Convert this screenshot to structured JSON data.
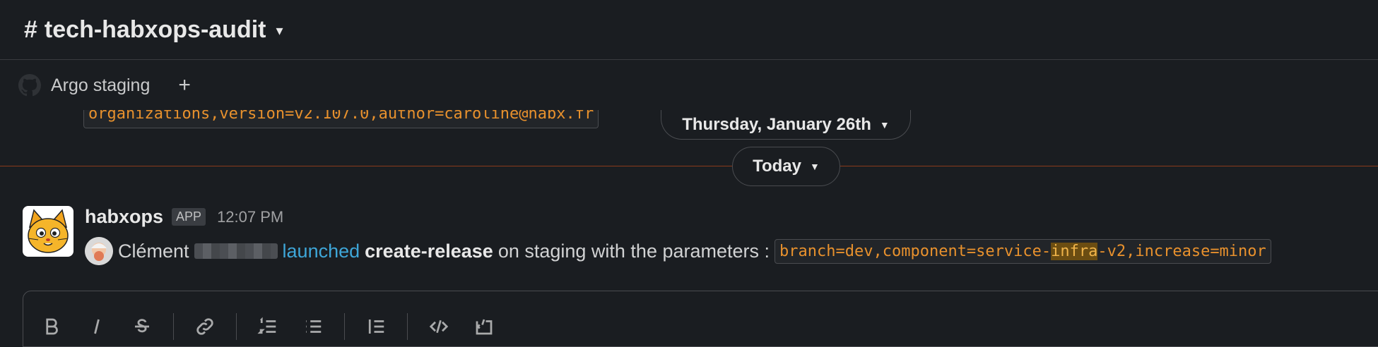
{
  "header": {
    "hash": "#",
    "channel_name": "tech-habxops-audit",
    "chevron": "⌄"
  },
  "bookmarks": {
    "items": [
      {
        "icon": "github-icon",
        "label": "Argo staging"
      }
    ],
    "add": "+"
  },
  "history": {
    "truncated_code": "organizations,version=v2.107.0,author=caroline@habx.fr",
    "date_separator": "Thursday, January 26th",
    "today_separator": "Today",
    "separator_color": "#8b3a1a"
  },
  "message": {
    "sender": "habxops",
    "badge": "APP",
    "time": "12:07 PM",
    "user_first_name": "Clément",
    "action_link": "launched",
    "workflow": "create-release",
    "text_mid": "on staging with the parameters :",
    "code_before": "branch=dev,component=service-",
    "code_highlight": "infra",
    "code_after": "-v2,increase=minor"
  },
  "composer": {
    "toolbar": [
      "bold-icon",
      "italic-icon",
      "strikethrough-icon",
      "link-icon",
      "ordered-list-icon",
      "bulleted-list-icon",
      "blockquote-icon",
      "code-icon",
      "code-block-icon"
    ]
  },
  "colors": {
    "link": "#3ea6d8",
    "code": "#e8912d",
    "background": "#1a1d21"
  }
}
